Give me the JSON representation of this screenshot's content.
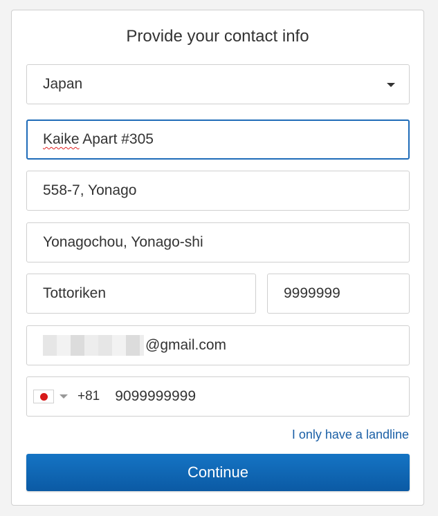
{
  "form": {
    "title": "Provide your contact info",
    "country": "Japan",
    "address_line1": "Kaike",
    "address_line1_rest": " Apart #305",
    "address_line2": "558-7, Yonago",
    "city": "Yonagochou, Yonago-shi",
    "prefecture": "Tottoriken",
    "postal_code": "9999999",
    "email_domain": "@gmail.com",
    "phone": {
      "flag_color": "#d71a1a",
      "dial_code": "+81",
      "number": "9099999999"
    },
    "landline_link": "I only have a landline",
    "continue_button": "Continue"
  },
  "colors": {
    "accent": "#1574c4",
    "link": "#1a5fa6",
    "focus_border": "#1e6bb8"
  }
}
